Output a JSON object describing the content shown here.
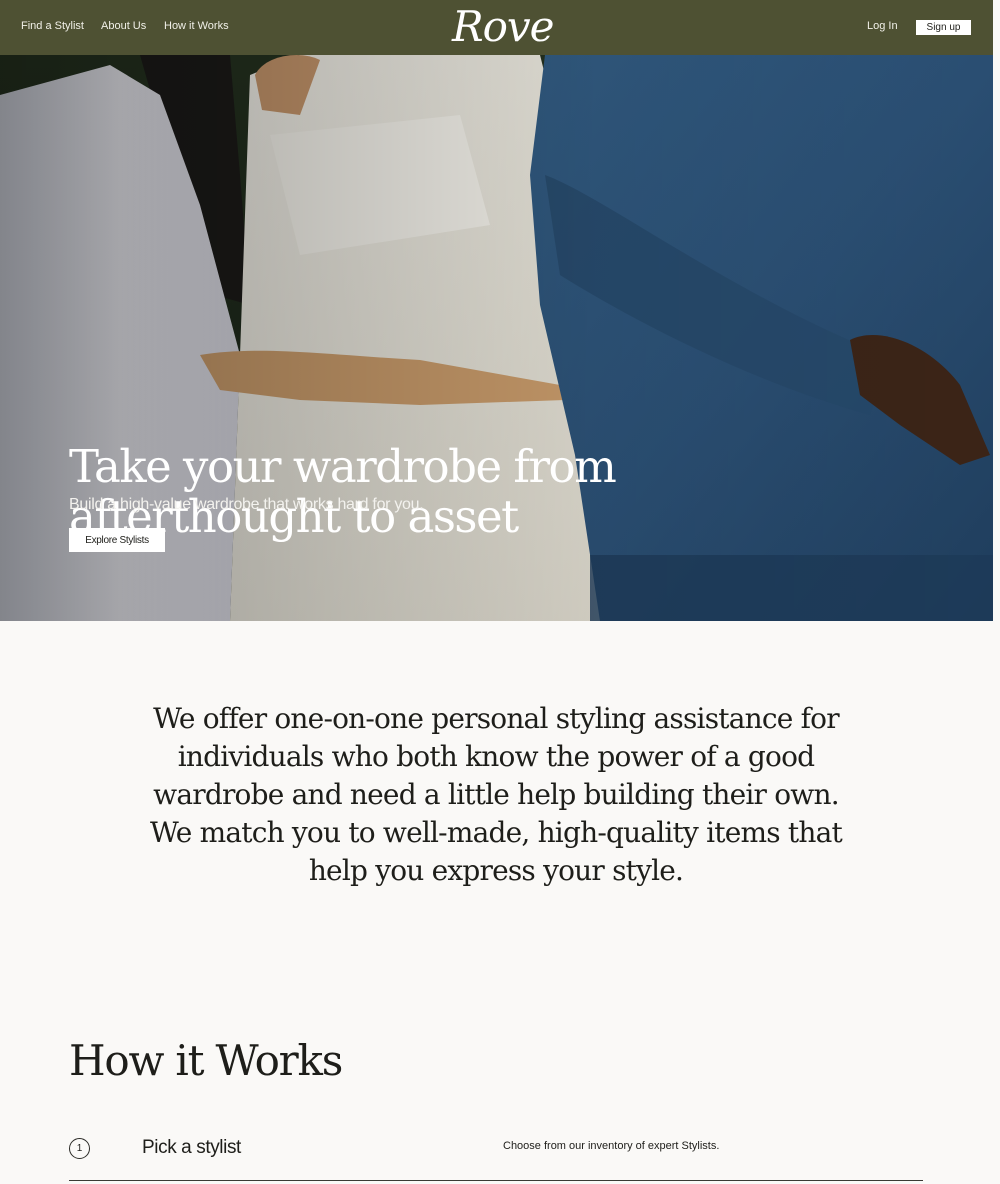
{
  "nav": {
    "find_stylist": "Find a Stylist",
    "about_us": "About Us",
    "how_it_works": "How it Works",
    "logo": "Rove",
    "log_in": "Log In",
    "sign_up": "Sign up"
  },
  "hero": {
    "title_line1": "Take your wardrobe from",
    "title_line2": "afterthought to asset",
    "subtitle": "Build a high-value wardrobe that works hard for you.",
    "cta": "Explore Stylists"
  },
  "intro": {
    "text": "We offer one-on-one personal styling assistance for individuals who both know the power of a good wardrobe and need a little help building their own. We match you to well-made, high-quality items that help you express your style."
  },
  "how_it_works": {
    "title": "How it Works",
    "steps": [
      {
        "number": "1",
        "title": "Pick a stylist",
        "description": "Choose from our inventory of expert Stylists."
      }
    ]
  },
  "colors": {
    "nav_bg": "#4e5133",
    "page_bg": "#faf9f7",
    "text": "#1e1e1a",
    "sweater_blue": "#2b4f73",
    "shirt_white": "#ecebe6"
  }
}
